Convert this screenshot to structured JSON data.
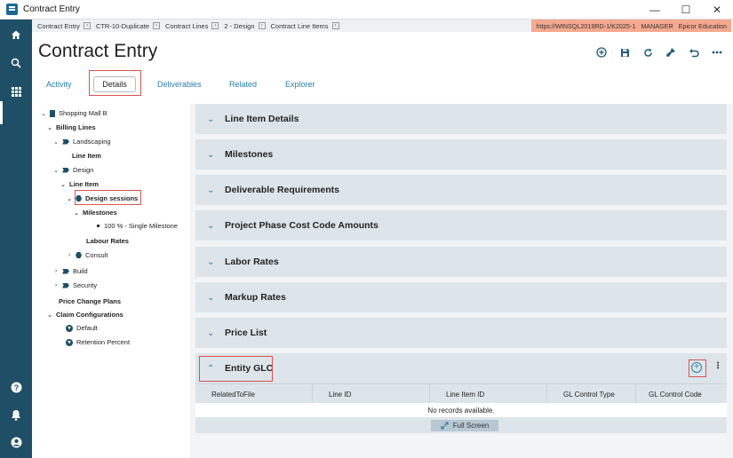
{
  "window": {
    "title": "Contract Entry"
  },
  "breadcrumb": [
    {
      "label": "Contract Entry"
    },
    {
      "label": "CTR-10-Duplicate"
    },
    {
      "label": "Contract Lines"
    },
    {
      "label": "2 - Design"
    },
    {
      "label": "Contract Line Items"
    }
  ],
  "server": {
    "url": "https://WINSQL2019RD-1/K2025-1",
    "role": "MANAGER",
    "company": "Epicor Education"
  },
  "page": {
    "title": "Contract Entry"
  },
  "toolbar_icons": [
    "add-icon",
    "save-icon",
    "refresh-icon",
    "clear-icon",
    "undo-icon",
    "more-icon"
  ],
  "tabs": [
    {
      "label": "Activity"
    },
    {
      "label": "Details"
    },
    {
      "label": "Deliverables"
    },
    {
      "label": "Related"
    },
    {
      "label": "Explorer"
    }
  ],
  "tree": {
    "root": "Shopping Mall B",
    "billing_lines": "Billing Lines",
    "landscaping": "Landscaping",
    "landscaping_line_item": "Line Item",
    "design": "Design",
    "design_line_item": "Line Item",
    "design_sessions": "Design sessions",
    "milestones": "Milestones",
    "milestone_1": "100 % - Single Milestone",
    "labour_rates": "Labour Rates",
    "consult": "Consult",
    "build": "Build",
    "security": "Security",
    "price_change_plans": "Price Change Plans",
    "claim_configurations": "Claim Configurations",
    "claim_default": "Default",
    "claim_retention": "Retention Percent"
  },
  "panels": [
    {
      "title": "Line Item Details"
    },
    {
      "title": "Milestones"
    },
    {
      "title": "Deliverable Requirements"
    },
    {
      "title": "Project Phase Cost Code Amounts"
    },
    {
      "title": "Labor Rates"
    },
    {
      "title": "Markup Rates"
    },
    {
      "title": "Price List"
    }
  ],
  "entity_glc": {
    "title": "Entity GLC",
    "columns": [
      "RelatedToFile",
      "Line ID",
      "Line Item ID",
      "GL Control Type",
      "GL Control Code"
    ],
    "empty_text": "No records available.",
    "full_screen": "Full Screen"
  },
  "colors": {
    "sidebar": "#1f4f67",
    "accent": "#2a7ea6",
    "panel": "#dde5ea",
    "highlight": "#d9534f",
    "server_badge": "#f4a98f"
  }
}
